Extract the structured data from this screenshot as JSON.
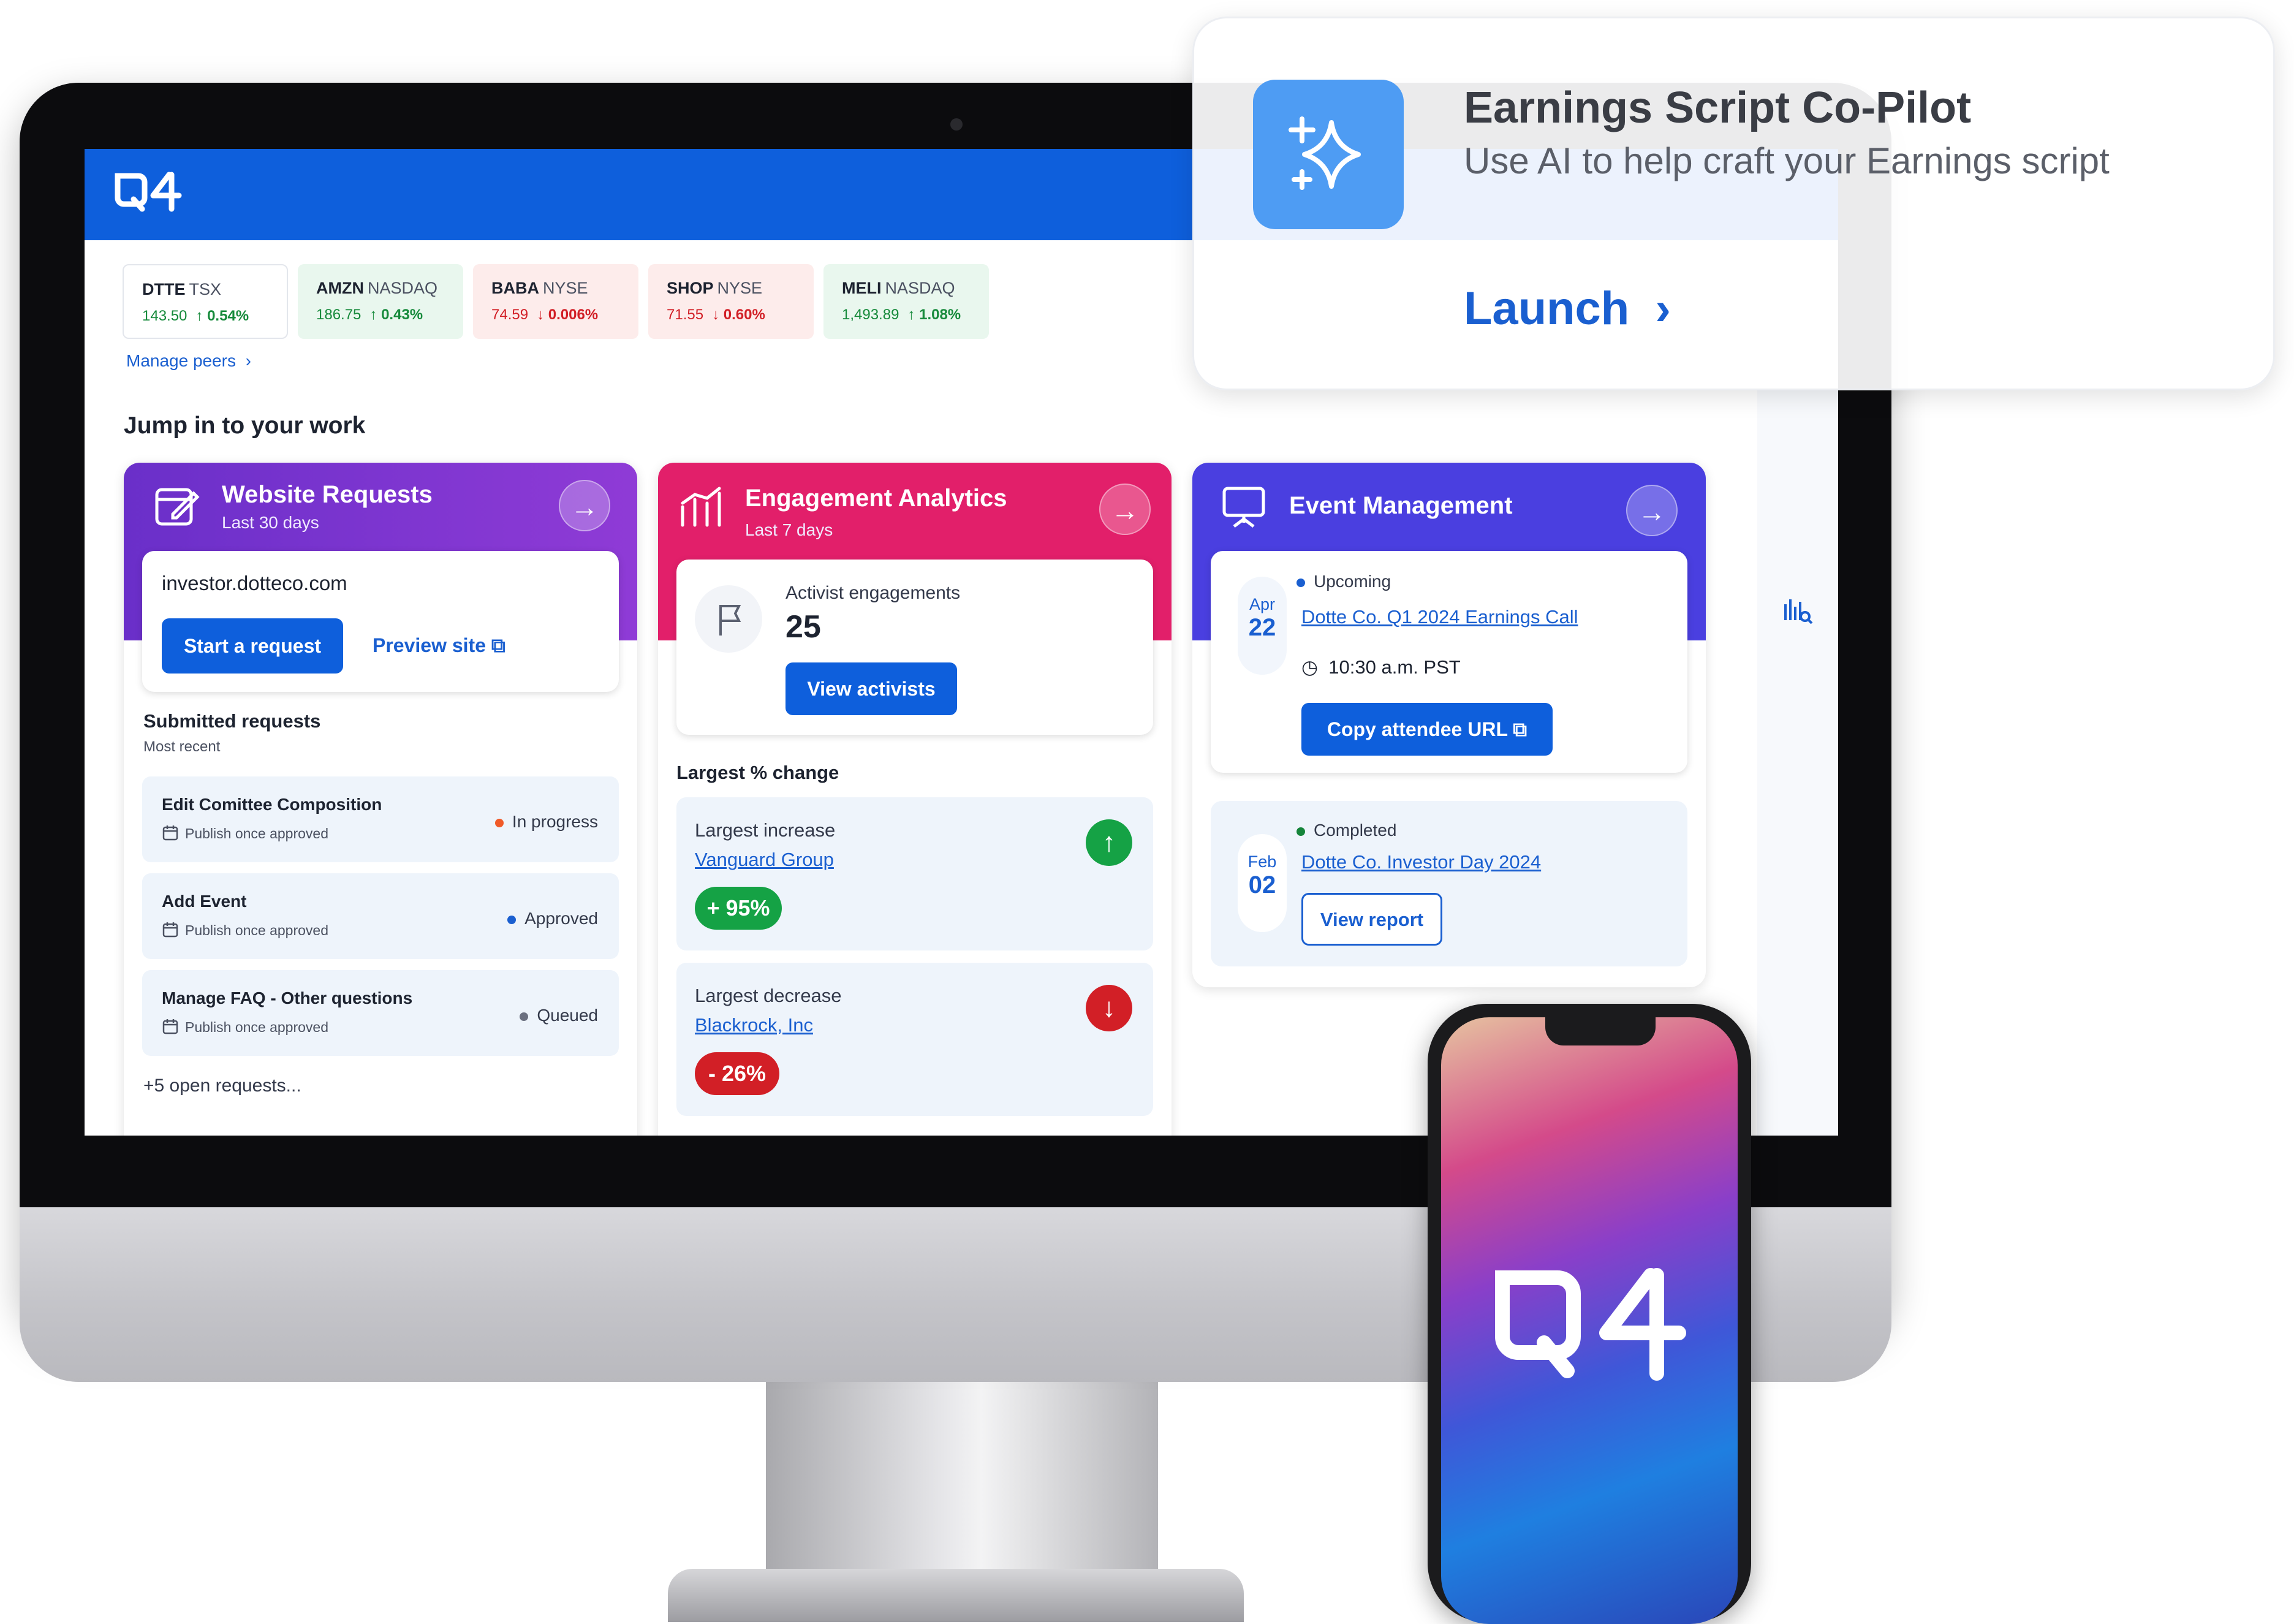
{
  "tickers": [
    {
      "symbol": "DTTE",
      "exchange": "TSX",
      "price": "143.50",
      "change": "0.54%",
      "trend": "up",
      "style": "neutral"
    },
    {
      "symbol": "AMZN",
      "exchange": "NASDAQ",
      "price": "186.75",
      "change": "0.43%",
      "trend": "up",
      "style": "up"
    },
    {
      "symbol": "BABA",
      "exchange": "NYSE",
      "price": "74.59",
      "change": "0.006%",
      "trend": "down",
      "style": "down"
    },
    {
      "symbol": "SHOP",
      "exchange": "NYSE",
      "price": "71.55",
      "change": "0.60%",
      "trend": "down",
      "style": "down"
    },
    {
      "symbol": "MELI",
      "exchange": "NASDAQ",
      "price": "1,493.89",
      "change": "1.08%",
      "trend": "up",
      "style": "up"
    }
  ],
  "manage_peers": "Manage peers",
  "section_title": "Jump in to your work",
  "website_requests": {
    "title": "Website Requests",
    "subtitle": "Last 30 days",
    "domain": "investor.dotteco.com",
    "start_button": "Start a request",
    "preview_link": "Preview site",
    "submitted_title": "Submitted requests",
    "submitted_sub": "Most recent",
    "requests": [
      {
        "title": "Edit Comittee Composition",
        "sub": "Publish once approved",
        "status": "In progress",
        "dot": "#f05a28"
      },
      {
        "title": "Add Event",
        "sub": "Publish once approved",
        "status": "Approved",
        "dot": "#1a5fd0"
      },
      {
        "title": "Manage FAQ - Other questions",
        "sub": "Publish once approved",
        "status": "Queued",
        "dot": "#6b7080"
      }
    ],
    "more": "+5 open requests..."
  },
  "engagement": {
    "title": "Engagement Analytics",
    "subtitle": "Last 7 days",
    "activist_label": "Activist engagements",
    "activist_count": "25",
    "view_button": "View activists",
    "largest_title": "Largest % change",
    "increase_label": "Largest increase",
    "increase_name": "Vanguard Group",
    "increase_value": "+ 95%",
    "decrease_label": "Largest decrease",
    "decrease_name": "Blackrock, Inc",
    "decrease_value": "- 26%"
  },
  "events": {
    "title": "Event Management",
    "upcoming_status": "Upcoming",
    "upcoming_month": "Apr",
    "upcoming_day": "22",
    "upcoming_name": "Dotte Co. Q1 2024 Earnings Call",
    "upcoming_time": "10:30 a.m. PST",
    "copy_button": "Copy attendee URL",
    "completed_status": "Completed",
    "completed_month": "Feb",
    "completed_day": "02",
    "completed_name": "Dotte Co. Investor Day 2024",
    "report_button": "View report"
  },
  "popup": {
    "title": "Earnings Script Co-Pilot",
    "subtitle": "Use AI to help craft your Earnings script",
    "launch": "Launch"
  },
  "colors": {
    "brand_blue": "#0e5fdc",
    "purple": "#7b2fd0",
    "pink": "#e21f6a",
    "indigo": "#4a3fe0",
    "green": "#15a245",
    "red": "#d21f26"
  }
}
